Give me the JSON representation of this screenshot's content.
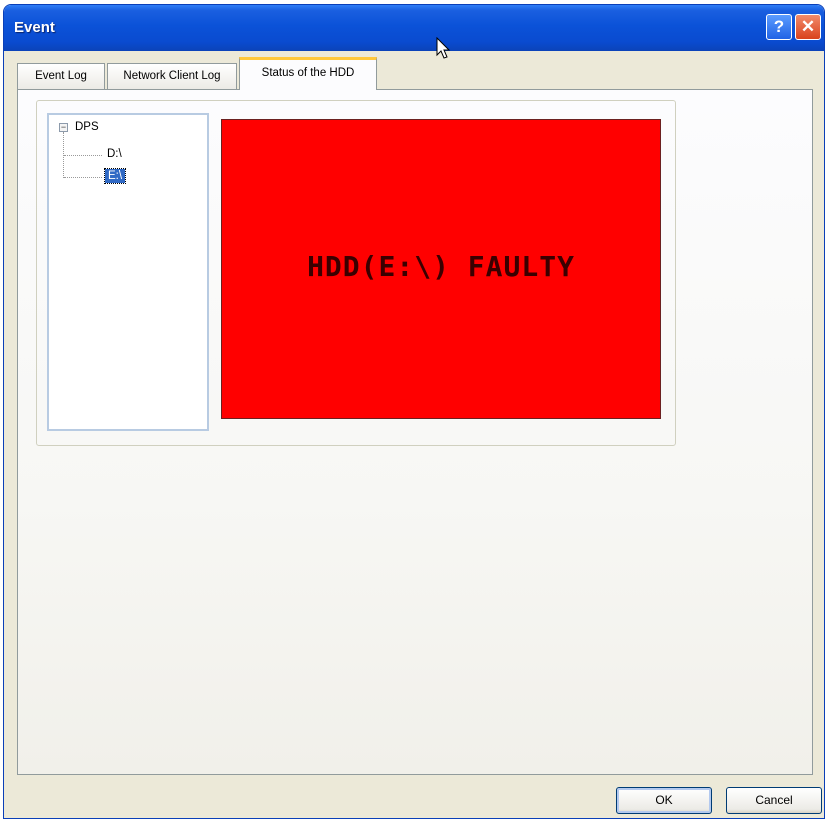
{
  "window": {
    "title": "Event",
    "help_label": "?",
    "close_label": "✕"
  },
  "tabs": [
    {
      "label": "Event Log",
      "active": false
    },
    {
      "label": "Network Client Log",
      "active": false
    },
    {
      "label": "Status of the HDD",
      "active": true
    }
  ],
  "tree": {
    "root": "DPS",
    "root_expander": "−",
    "children": [
      {
        "label": "D:\\",
        "selected": false
      },
      {
        "label": "E:\\",
        "selected": true
      }
    ]
  },
  "status": {
    "message": "HDD(E:\\) FAULTY",
    "background_color": "#ff0000"
  },
  "buttons": {
    "ok": "OK",
    "cancel": "Cancel"
  },
  "colors": {
    "titlebar": "#0b52d8",
    "selection": "#316ac5",
    "status_fault": "#ff0000"
  }
}
